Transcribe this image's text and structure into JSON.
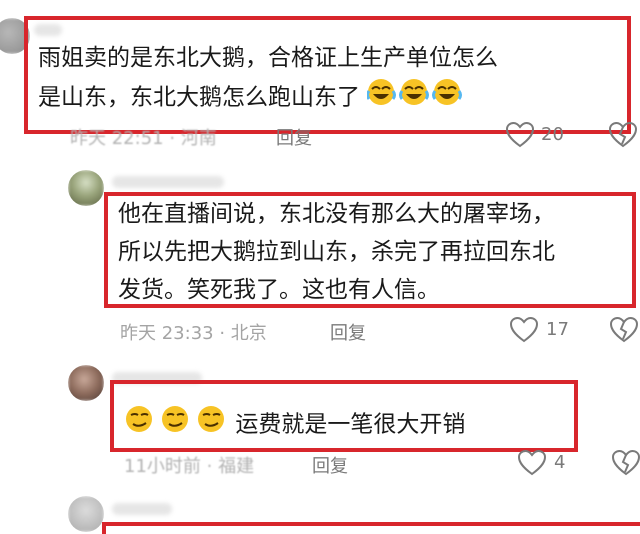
{
  "comments": [
    {
      "line1": "雨姐卖的是东北大鹅，合格证上生产单位怎么",
      "line2": "是山东，东北大鹅怎么跑山东了",
      "emoji": "laughing-tears-icon",
      "time": "昨天 22:51 · 河南",
      "reply": "回复",
      "likes": "20"
    },
    {
      "line1": "他在直播间说，东北没有那么大的屠宰场，",
      "line2": "所以先把大鹅拉到山东，杀完了再拉回东北",
      "line3": "发货。笑死我了。这也有人信。",
      "time": "昨天 23:33 · 北京",
      "reply": "回复",
      "likes": "17"
    },
    {
      "text": "运费就是一笔很大开销",
      "emoji": "smirk-face-icon",
      "time": "11小时前 · 福建",
      "reply": "回复",
      "likes": "4"
    }
  ],
  "colors": {
    "highlight_border": "#d8262c",
    "meta_text": "#a4a4a4",
    "body_text": "#1a1a1a"
  }
}
